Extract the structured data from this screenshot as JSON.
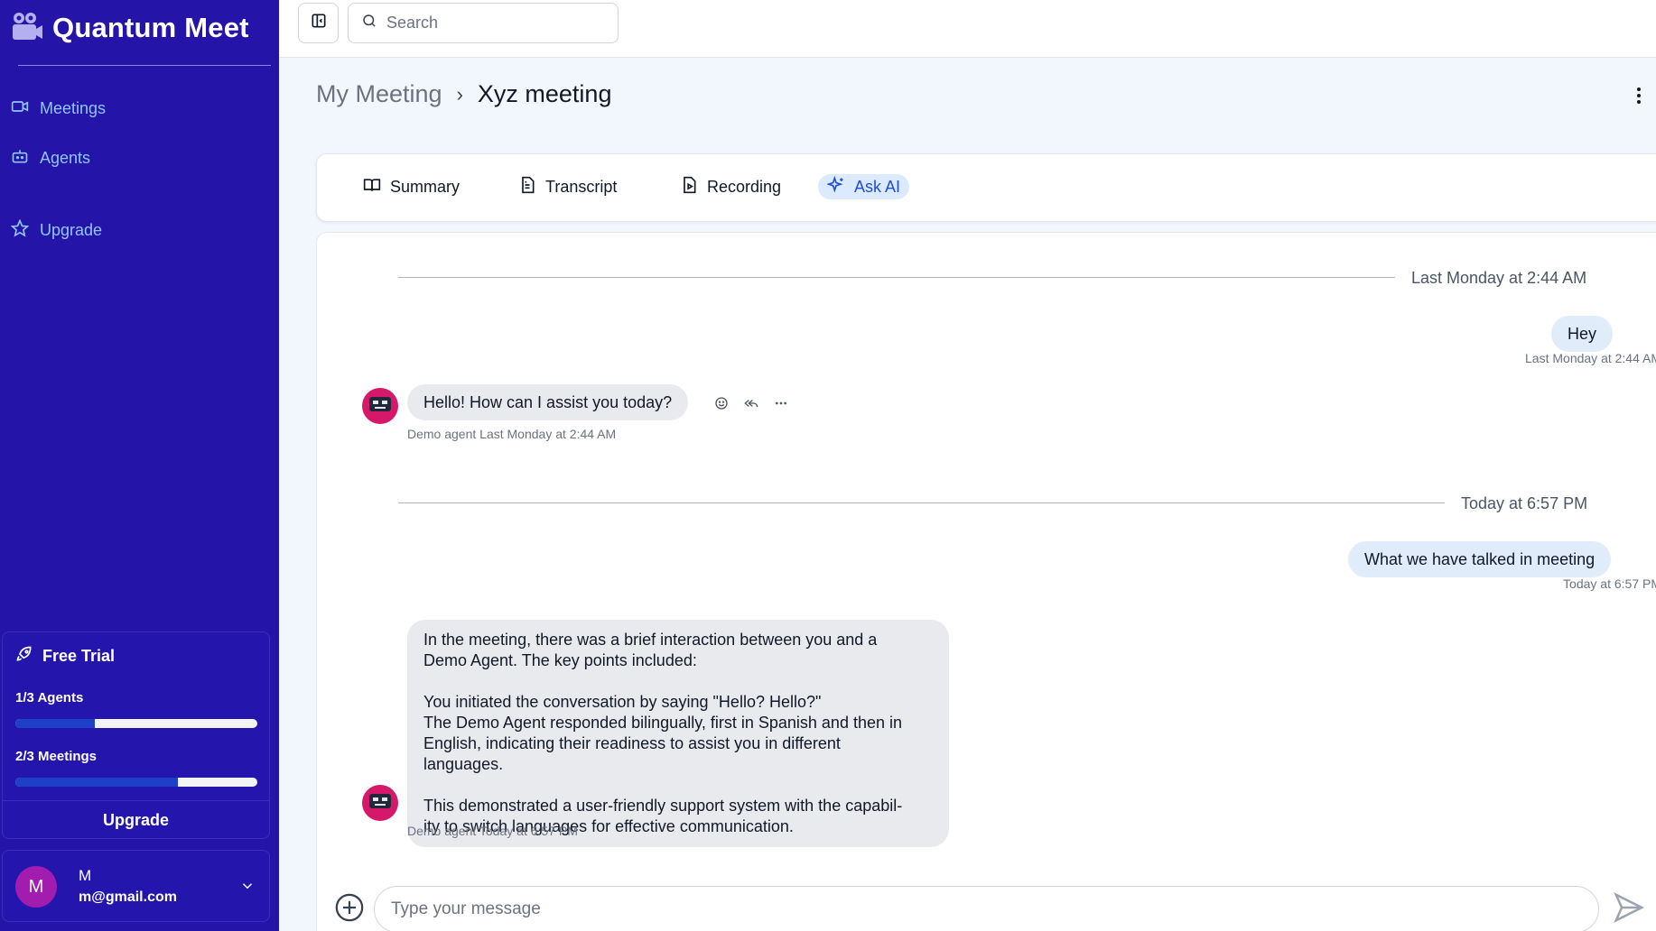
{
  "app": {
    "name": "Quantum Meet",
    "logo_icon": "video-camera-icon"
  },
  "sidebar": {
    "items": [
      {
        "label": "Meetings",
        "icon": "video-icon"
      },
      {
        "label": "Agents",
        "icon": "bot-icon"
      },
      {
        "label": "Upgrade",
        "icon": "star-icon"
      }
    ]
  },
  "trial": {
    "title": "Free Trial",
    "agents_label": "1/3 Agents",
    "agents_progress": 0.33,
    "meetings_label": "2/3 Meetings",
    "meetings_progress": 0.67,
    "upgrade_label": "Upgrade"
  },
  "user": {
    "initial": "M",
    "name": "M",
    "email": "m@gmail.com"
  },
  "topbar": {
    "search_placeholder": "Search"
  },
  "breadcrumb": {
    "parent": "My Meeting",
    "separator": "›",
    "current": "Xyz meeting"
  },
  "tabs": [
    {
      "label": "Summary",
      "icon": "book-icon",
      "active": false
    },
    {
      "label": "Transcript",
      "icon": "file-text-icon",
      "active": false
    },
    {
      "label": "Recording",
      "icon": "file-video-icon",
      "active": false
    },
    {
      "label": "Ask AI",
      "icon": "sparkles-icon",
      "active": true
    }
  ],
  "chat": {
    "dividers": [
      "Last Monday at 2:44 AM",
      "Today at 6:57 PM"
    ],
    "messages": [
      {
        "from": "user",
        "text": "Hey",
        "time": "Last Monday at 2:44 AM"
      },
      {
        "from": "agent",
        "text": "Hello! How can I assist you today?",
        "sender": "Demo agent",
        "time": "Last Monday at 2:44 AM"
      },
      {
        "from": "user",
        "text": "What we have talked in meeting",
        "time": "Today at 6:57 PM"
      },
      {
        "from": "agent",
        "sender": "Demo agent",
        "time": "Today at 6:57 PM",
        "lines": [
          "In the meeting, there was a brief interaction between you and a",
          "Demo Agent. The key points included:",
          "",
          "You initiated the conversation by saying \"Hello? Hello?\"",
          "The Demo Agent responded bilingually, first in Spanish and then in",
          "English, indicating their readiness to assist you in different",
          "languages.",
          "",
          "This demonstrated a user-friendly support system with the capabil-",
          "ity to switch languages for effective communication."
        ]
      }
    ]
  },
  "composer": {
    "placeholder": "Type your message"
  },
  "colors": {
    "sidebar_bg": "#2414a8",
    "accent": "#1d4ed8",
    "agent_avatar": "#d6186a",
    "user_avatar": "#a21caf"
  }
}
